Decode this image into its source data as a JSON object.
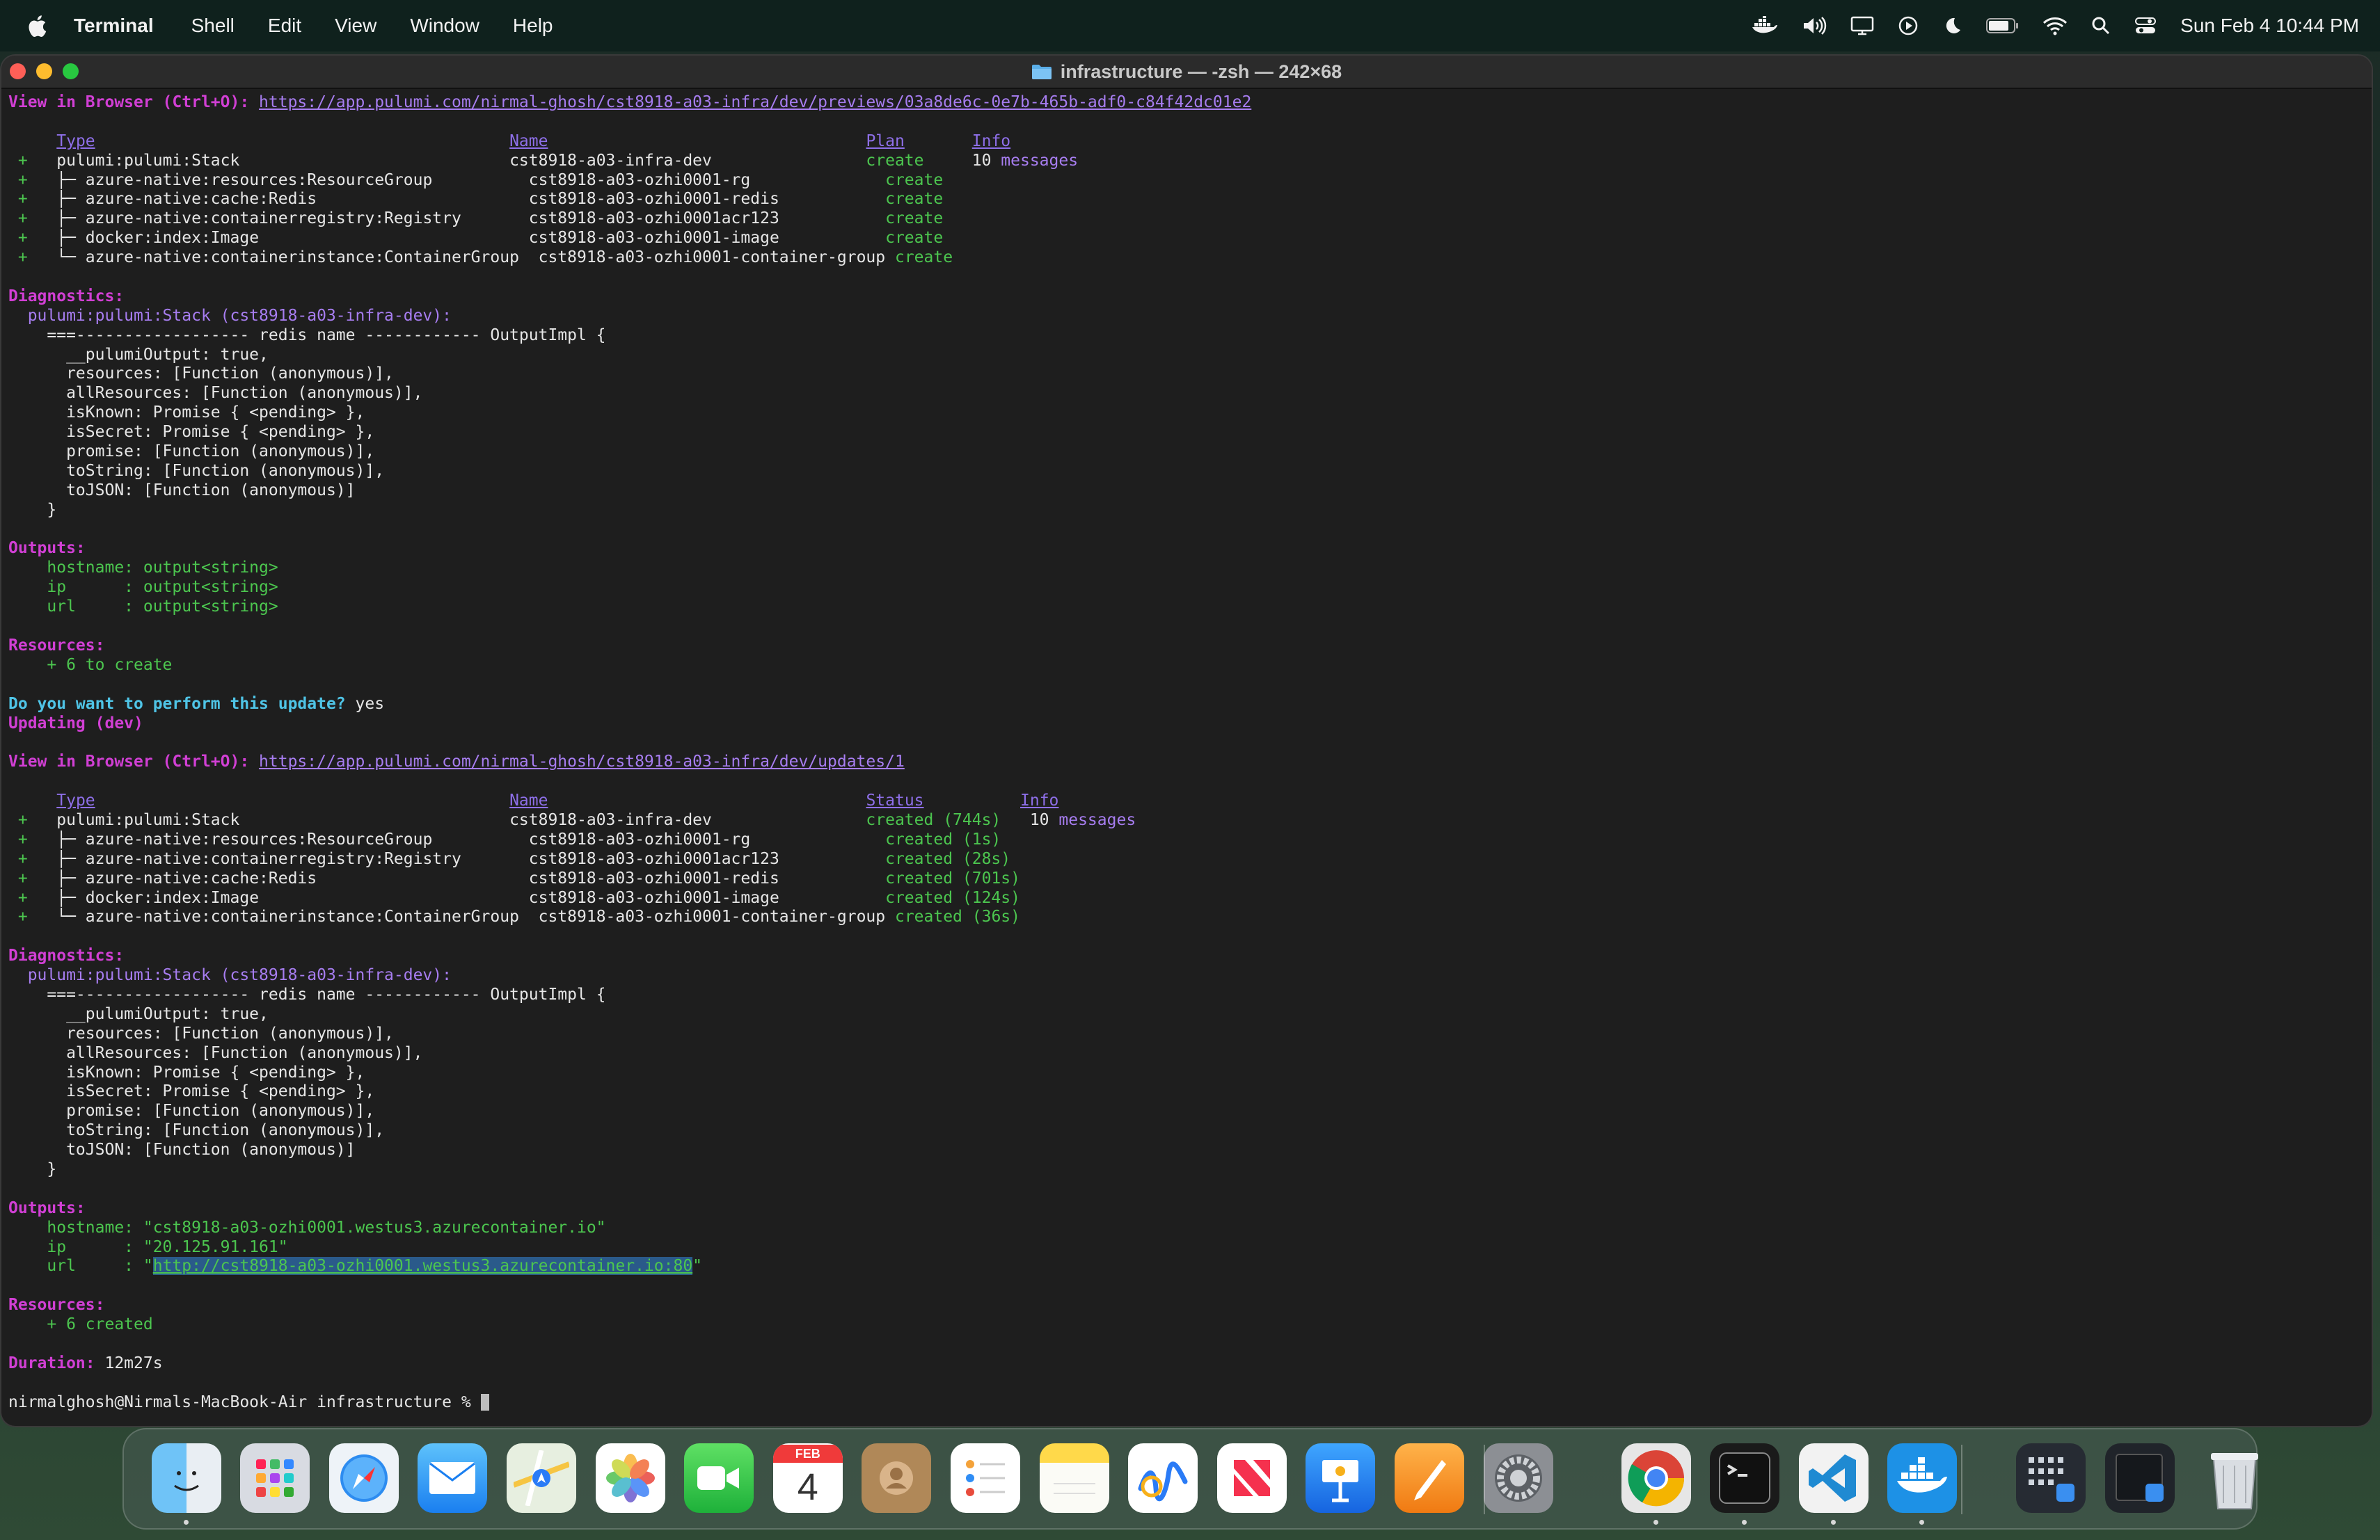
{
  "menubar": {
    "app_name": "Terminal",
    "items": [
      "Shell",
      "Edit",
      "View",
      "Window",
      "Help"
    ],
    "clock": "Sun Feb 4  10:44 PM",
    "status_icons": [
      "docker-icon",
      "volume-icon",
      "display-icon",
      "play-icon",
      "moon-icon",
      "battery-icon",
      "wifi-icon",
      "search-icon",
      "control-center-icon"
    ]
  },
  "window": {
    "title": "infrastructure — -zsh — 242×68"
  },
  "terminal": {
    "lines": [
      [
        {
          "t": "View in Browser (Ctrl+O): ",
          "c": "mag"
        },
        {
          "t": "https://app.pulumi.com/nirmal-ghosh/cst8918-a03-infra/dev/previews/03a8de6c-0e7b-465b-adf0-c84f42dc01e2",
          "c": "link"
        }
      ],
      [],
      [
        {
          "t": "     "
        },
        {
          "t": "Type",
          "c": "hdr"
        },
        {
          "t": "                                           "
        },
        {
          "t": "Name",
          "c": "hdr"
        },
        {
          "t": "                                 "
        },
        {
          "t": "Plan",
          "c": "hdr"
        },
        {
          "t": "       "
        },
        {
          "t": "Info",
          "c": "hdr"
        }
      ],
      [
        {
          "t": " +   ",
          "c": "grn"
        },
        {
          "t": "pulumi:pulumi:Stack                            cst8918-a03-infra-dev                "
        },
        {
          "t": "create",
          "c": "grn"
        },
        {
          "t": "     10 "
        },
        {
          "t": "messages",
          "c": "pur"
        }
      ],
      [
        {
          "t": " +   ",
          "c": "grn"
        },
        {
          "t": "├─ azure-native:resources:ResourceGroup          cst8918-a03-ozhi0001-rg              "
        },
        {
          "t": "create",
          "c": "grn"
        }
      ],
      [
        {
          "t": " +   ",
          "c": "grn"
        },
        {
          "t": "├─ azure-native:cache:Redis                      cst8918-a03-ozhi0001-redis           "
        },
        {
          "t": "create",
          "c": "grn"
        }
      ],
      [
        {
          "t": " +   ",
          "c": "grn"
        },
        {
          "t": "├─ azure-native:containerregistry:Registry       cst8918-a03-ozhi0001acr123           "
        },
        {
          "t": "create",
          "c": "grn"
        }
      ],
      [
        {
          "t": " +   ",
          "c": "grn"
        },
        {
          "t": "├─ docker:index:Image                            cst8918-a03-ozhi0001-image           "
        },
        {
          "t": "create",
          "c": "grn"
        }
      ],
      [
        {
          "t": " +   ",
          "c": "grn"
        },
        {
          "t": "└─ azure-native:containerinstance:ContainerGroup  cst8918-a03-ozhi0001-container-group "
        },
        {
          "t": "create",
          "c": "grn"
        }
      ],
      [],
      [
        {
          "t": "Diagnostics:",
          "c": "mag"
        }
      ],
      [
        {
          "t": "  pulumi:pulumi:Stack (cst8918-a03-infra-dev):",
          "c": "pur"
        }
      ],
      [
        {
          "t": "    ===------------------ redis name ------------ OutputImpl {"
        }
      ],
      [
        {
          "t": "      __pulumiOutput: true,"
        }
      ],
      [
        {
          "t": "      resources: [Function (anonymous)],"
        }
      ],
      [
        {
          "t": "      allResources: [Function (anonymous)],"
        }
      ],
      [
        {
          "t": "      isKnown: Promise { <pending> },"
        }
      ],
      [
        {
          "t": "      isSecret: Promise { <pending> },"
        }
      ],
      [
        {
          "t": "      promise: [Function (anonymous)],"
        }
      ],
      [
        {
          "t": "      toString: [Function (anonymous)],"
        }
      ],
      [
        {
          "t": "      toJSON: [Function (anonymous)]"
        }
      ],
      [
        {
          "t": "    }"
        }
      ],
      [],
      [
        {
          "t": "Outputs:",
          "c": "mag"
        }
      ],
      [
        {
          "t": "    hostname: output<string>",
          "c": "grn"
        }
      ],
      [
        {
          "t": "    ip      : output<string>",
          "c": "grn"
        }
      ],
      [
        {
          "t": "    url     : output<string>",
          "c": "grn"
        }
      ],
      [],
      [
        {
          "t": "Resources:",
          "c": "mag"
        }
      ],
      [
        {
          "t": "    + 6 to create",
          "c": "grn"
        }
      ],
      [],
      [
        {
          "t": "Do you want to perform this update? ",
          "c": "cyan"
        },
        {
          "t": "yes"
        }
      ],
      [
        {
          "t": "Updating (dev)",
          "c": "mag"
        }
      ],
      [],
      [
        {
          "t": "View in Browser (Ctrl+O): ",
          "c": "mag"
        },
        {
          "t": "https://app.pulumi.com/nirmal-ghosh/cst8918-a03-infra/dev/updates/1",
          "c": "link"
        }
      ],
      [],
      [
        {
          "t": "     "
        },
        {
          "t": "Type",
          "c": "hdr"
        },
        {
          "t": "                                           "
        },
        {
          "t": "Name",
          "c": "hdr"
        },
        {
          "t": "                                 "
        },
        {
          "t": "Status",
          "c": "hdr"
        },
        {
          "t": "          "
        },
        {
          "t": "Info",
          "c": "hdr"
        }
      ],
      [
        {
          "t": " +   ",
          "c": "grn"
        },
        {
          "t": "pulumi:pulumi:Stack                            cst8918-a03-infra-dev                "
        },
        {
          "t": "created (744s)",
          "c": "grn"
        },
        {
          "t": "   10 "
        },
        {
          "t": "messages",
          "c": "pur"
        }
      ],
      [
        {
          "t": " +   ",
          "c": "grn"
        },
        {
          "t": "├─ azure-native:resources:ResourceGroup          cst8918-a03-ozhi0001-rg              "
        },
        {
          "t": "created (1s)",
          "c": "grn"
        }
      ],
      [
        {
          "t": " +   ",
          "c": "grn"
        },
        {
          "t": "├─ azure-native:containerregistry:Registry       cst8918-a03-ozhi0001acr123           "
        },
        {
          "t": "created (28s)",
          "c": "grn"
        }
      ],
      [
        {
          "t": " +   ",
          "c": "grn"
        },
        {
          "t": "├─ azure-native:cache:Redis                      cst8918-a03-ozhi0001-redis           "
        },
        {
          "t": "created (701s)",
          "c": "grn"
        }
      ],
      [
        {
          "t": " +   ",
          "c": "grn"
        },
        {
          "t": "├─ docker:index:Image                            cst8918-a03-ozhi0001-image           "
        },
        {
          "t": "created (124s)",
          "c": "grn"
        }
      ],
      [
        {
          "t": " +   ",
          "c": "grn"
        },
        {
          "t": "└─ azure-native:containerinstance:ContainerGroup  cst8918-a03-ozhi0001-container-group "
        },
        {
          "t": "created (36s)",
          "c": "grn"
        }
      ],
      [],
      [
        {
          "t": "Diagnostics:",
          "c": "mag"
        }
      ],
      [
        {
          "t": "  pulumi:pulumi:Stack (cst8918-a03-infra-dev):",
          "c": "pur"
        }
      ],
      [
        {
          "t": "    ===------------------ redis name ------------ OutputImpl {"
        }
      ],
      [
        {
          "t": "      __pulumiOutput: true,"
        }
      ],
      [
        {
          "t": "      resources: [Function (anonymous)],"
        }
      ],
      [
        {
          "t": "      allResources: [Function (anonymous)],"
        }
      ],
      [
        {
          "t": "      isKnown: Promise { <pending> },"
        }
      ],
      [
        {
          "t": "      isSecret: Promise { <pending> },"
        }
      ],
      [
        {
          "t": "      promise: [Function (anonymous)],"
        }
      ],
      [
        {
          "t": "      toString: [Function (anonymous)],"
        }
      ],
      [
        {
          "t": "      toJSON: [Function (anonymous)]"
        }
      ],
      [
        {
          "t": "    }"
        }
      ],
      [],
      [
        {
          "t": "Outputs:",
          "c": "mag"
        }
      ],
      [
        {
          "t": "    hostname: \"cst8918-a03-ozhi0001.westus3.azurecontainer.io\"",
          "c": "grn"
        }
      ],
      [
        {
          "t": "    ip      : \"20.125.91.161\"",
          "c": "grn"
        }
      ],
      [
        {
          "t": "    url     : \"",
          "c": "grn"
        },
        {
          "t": "http://cst8918-a03-ozhi0001.westus3.azurecontainer.io:80",
          "c": "sel"
        },
        {
          "t": "\"",
          "c": "grn"
        }
      ],
      [],
      [
        {
          "t": "Resources:",
          "c": "mag"
        }
      ],
      [
        {
          "t": "    + 6 created",
          "c": "grn"
        }
      ],
      [],
      [
        {
          "t": "Duration: ",
          "c": "mag"
        },
        {
          "t": "12m27s"
        }
      ],
      [],
      [
        {
          "t": "nirmalghosh@Nirmals-MacBook-Air infrastructure % "
        },
        {
          "t": "",
          "c": "cursor"
        }
      ]
    ]
  },
  "dock": {
    "apps": [
      {
        "name": "finder-icon",
        "running": true
      },
      {
        "name": "launchpad-icon",
        "running": false
      },
      {
        "name": "safari-icon",
        "running": false
      },
      {
        "name": "mail-icon",
        "running": false
      },
      {
        "name": "maps-icon",
        "running": false
      },
      {
        "name": "photos-icon",
        "running": false
      },
      {
        "name": "facetime-icon",
        "running": false
      },
      {
        "name": "calendar-icon",
        "running": false,
        "month": "FEB",
        "day": "4"
      },
      {
        "name": "contacts-icon",
        "running": false
      },
      {
        "name": "reminders-icon",
        "running": false
      },
      {
        "name": "notes-icon",
        "running": false
      },
      {
        "name": "freeform-icon",
        "running": false
      },
      {
        "name": "news-icon",
        "running": false
      },
      {
        "name": "keynote-icon",
        "running": false
      },
      {
        "name": "pages-icon",
        "running": false
      },
      {
        "name": "system-settings-icon",
        "running": false
      },
      {
        "name": "chrome-icon",
        "running": true
      },
      {
        "name": "terminal-icon",
        "running": true
      },
      {
        "name": "vscode-icon",
        "running": true
      },
      {
        "name": "docker-icon",
        "running": true
      },
      {
        "name": "downloads-stack-icon",
        "running": false
      },
      {
        "name": "recent-window-icon",
        "running": false
      },
      {
        "name": "trash-icon",
        "running": false
      }
    ]
  }
}
